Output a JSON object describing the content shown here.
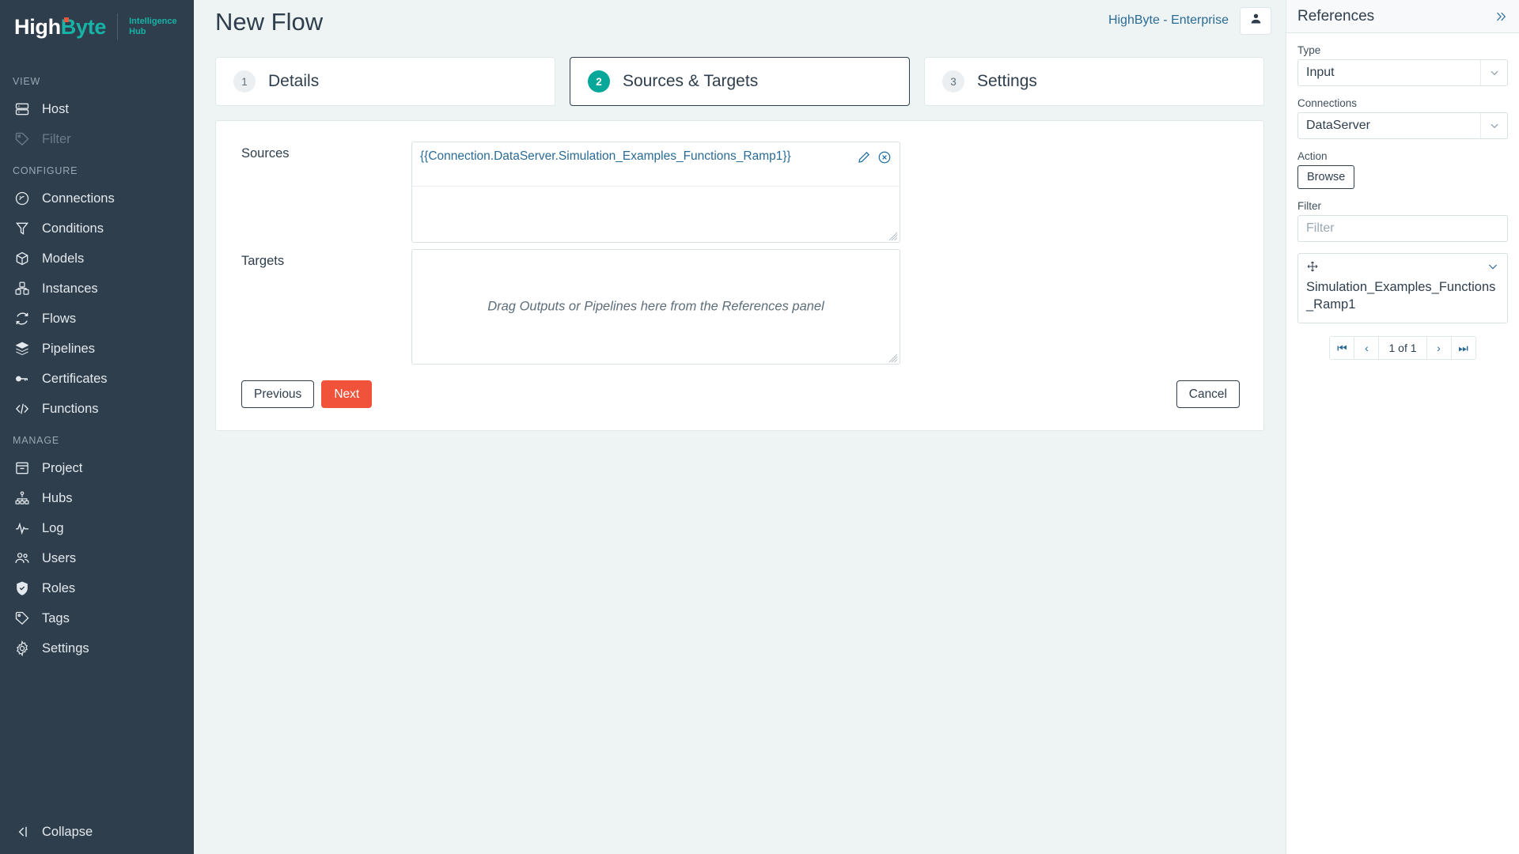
{
  "brand": {
    "name_part1": "High",
    "name_part2": "Byte",
    "sub_line1": "Intelligence",
    "sub_line2": "Hub",
    "accent_teal": "#16b3a6",
    "accent_dot": "#f0533a",
    "sidebar_bg": "#2f3e4c"
  },
  "sidebar": {
    "groups": [
      {
        "title": "VIEW",
        "items": [
          {
            "label": "Host",
            "icon": "server-icon",
            "disabled": false
          },
          {
            "label": "Filter",
            "icon": "tag-icon",
            "disabled": true
          }
        ]
      },
      {
        "title": "CONFIGURE",
        "items": [
          {
            "label": "Connections",
            "icon": "connection-icon",
            "disabled": false
          },
          {
            "label": "Conditions",
            "icon": "funnel-icon",
            "disabled": false
          },
          {
            "label": "Models",
            "icon": "cube-icon",
            "disabled": false
          },
          {
            "label": "Instances",
            "icon": "instances-icon",
            "disabled": false
          },
          {
            "label": "Flows",
            "icon": "refresh-icon",
            "disabled": false
          },
          {
            "label": "Pipelines",
            "icon": "layers-icon",
            "disabled": false
          },
          {
            "label": "Certificates",
            "icon": "key-icon",
            "disabled": false
          },
          {
            "label": "Functions",
            "icon": "code-icon",
            "disabled": false
          }
        ]
      },
      {
        "title": "MANAGE",
        "items": [
          {
            "label": "Project",
            "icon": "archive-icon",
            "disabled": false
          },
          {
            "label": "Hubs",
            "icon": "hierarchy-icon",
            "disabled": false
          },
          {
            "label": "Log",
            "icon": "activity-icon",
            "disabled": false
          },
          {
            "label": "Users",
            "icon": "users-icon",
            "disabled": false
          },
          {
            "label": "Roles",
            "icon": "shield-check-icon",
            "disabled": false
          },
          {
            "label": "Tags",
            "icon": "tag-icon",
            "disabled": false
          },
          {
            "label": "Settings",
            "icon": "gear-icon",
            "disabled": false
          }
        ]
      }
    ],
    "collapse_label": "Collapse",
    "collapse_icon": "collapse-left-icon"
  },
  "topbar": {
    "tenant": "HighByte - Enterprise",
    "avatar_icon": "user-icon"
  },
  "page": {
    "title": "New Flow"
  },
  "steps": [
    {
      "num": "1",
      "label": "Details",
      "active": false
    },
    {
      "num": "2",
      "label": "Sources & Targets",
      "active": true
    },
    {
      "num": "3",
      "label": "Settings",
      "active": false
    }
  ],
  "form": {
    "sources_label": "Sources",
    "sources_items": [
      {
        "value": "{{Connection.DataServer.Simulation_Examples_Functions_Ramp1}}",
        "edit_icon": "pencil-icon",
        "remove_icon": "remove-circle-icon"
      }
    ],
    "targets_label": "Targets",
    "targets_placeholder": "Drag Outputs or Pipelines here from the References panel"
  },
  "buttons": {
    "previous": "Previous",
    "next": "Next",
    "cancel": "Cancel",
    "next_color": "#f0533a"
  },
  "references": {
    "title": "References",
    "collapse_icon": "double-chevron-right-icon",
    "type_label": "Type",
    "type_value": "Input",
    "connections_label": "Connections",
    "connections_value": "DataServer",
    "action_label": "Action",
    "browse_label": "Browse",
    "filter_label": "Filter",
    "filter_value": "",
    "filter_placeholder": "Filter",
    "items": [
      {
        "name": "Simulation_Examples_Functions_Ramp1",
        "drag_icon": "move-icon",
        "expand_icon": "chevron-down-icon"
      }
    ],
    "pager": {
      "first": "⏮",
      "prev": "‹",
      "label": "1 of 1",
      "next": "›",
      "last": "⏭"
    }
  }
}
